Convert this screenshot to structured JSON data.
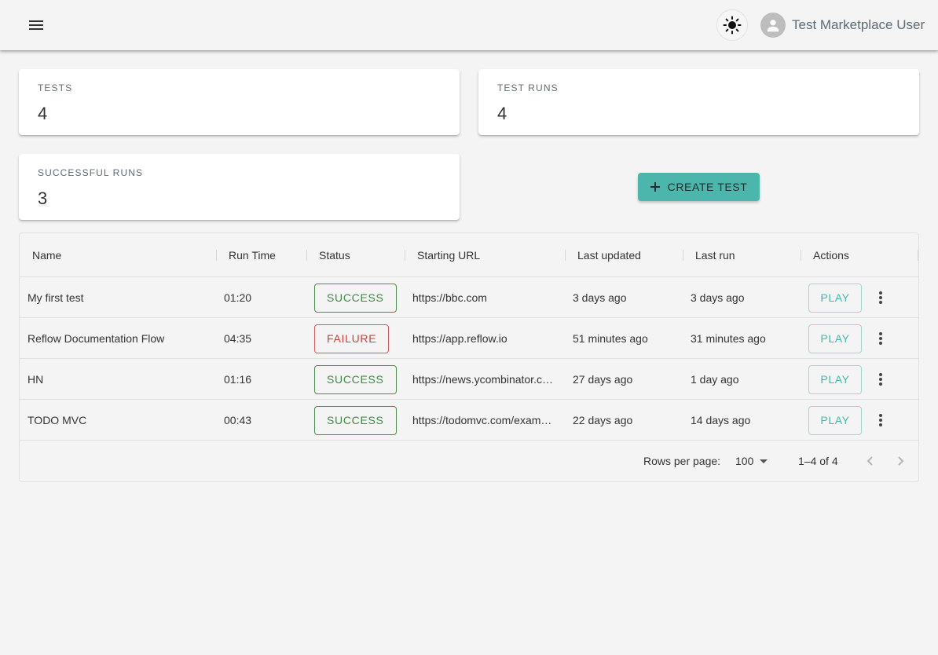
{
  "appbar": {
    "menu_icon": "menu-icon",
    "theme_icon": "sun-icon",
    "avatar_icon": "person-icon",
    "user_name": "Test Marketplace User"
  },
  "stats": {
    "tests": {
      "label": "TESTS",
      "value": "4"
    },
    "test_runs": {
      "label": "TEST RUNS",
      "value": "4"
    },
    "successful_runs": {
      "label": "SUCCESSFUL RUNS",
      "value": "3"
    }
  },
  "create_button": {
    "label": "CREATE TEST",
    "icon": "plus-icon"
  },
  "table": {
    "columns": [
      "Name",
      "Run Time",
      "Status",
      "Starting URL",
      "Last updated",
      "Last run",
      "Actions"
    ],
    "rows": [
      {
        "name": "My first test",
        "run_time": "01:20",
        "status": "SUCCESS",
        "url": "https://bbc.com",
        "last_updated": "3 days ago",
        "last_run": "3 days ago",
        "action": "PLAY"
      },
      {
        "name": "Reflow Documentation Flow",
        "run_time": "04:35",
        "status": "FAILURE",
        "url": "https://app.reflow.io",
        "last_updated": "51 minutes ago",
        "last_run": "31 minutes ago",
        "action": "PLAY"
      },
      {
        "name": "HN",
        "run_time": "01:16",
        "status": "SUCCESS",
        "url": "https://news.ycombinator.com",
        "last_updated": "27 days ago",
        "last_run": "1 day ago",
        "action": "PLAY"
      },
      {
        "name": "TODO MVC",
        "run_time": "00:43",
        "status": "SUCCESS",
        "url": "https://todomvc.com/examples",
        "last_updated": "22 days ago",
        "last_run": "14 days ago",
        "action": "PLAY"
      }
    ],
    "pagination": {
      "rows_per_page_label": "Rows per page:",
      "rows_per_page_value": "100",
      "range": "1–4 of 4"
    }
  },
  "colors": {
    "accent": "#4db6ac",
    "success": "#3f8a45",
    "failure": "#c8413f",
    "background": "#f4f4f4"
  }
}
